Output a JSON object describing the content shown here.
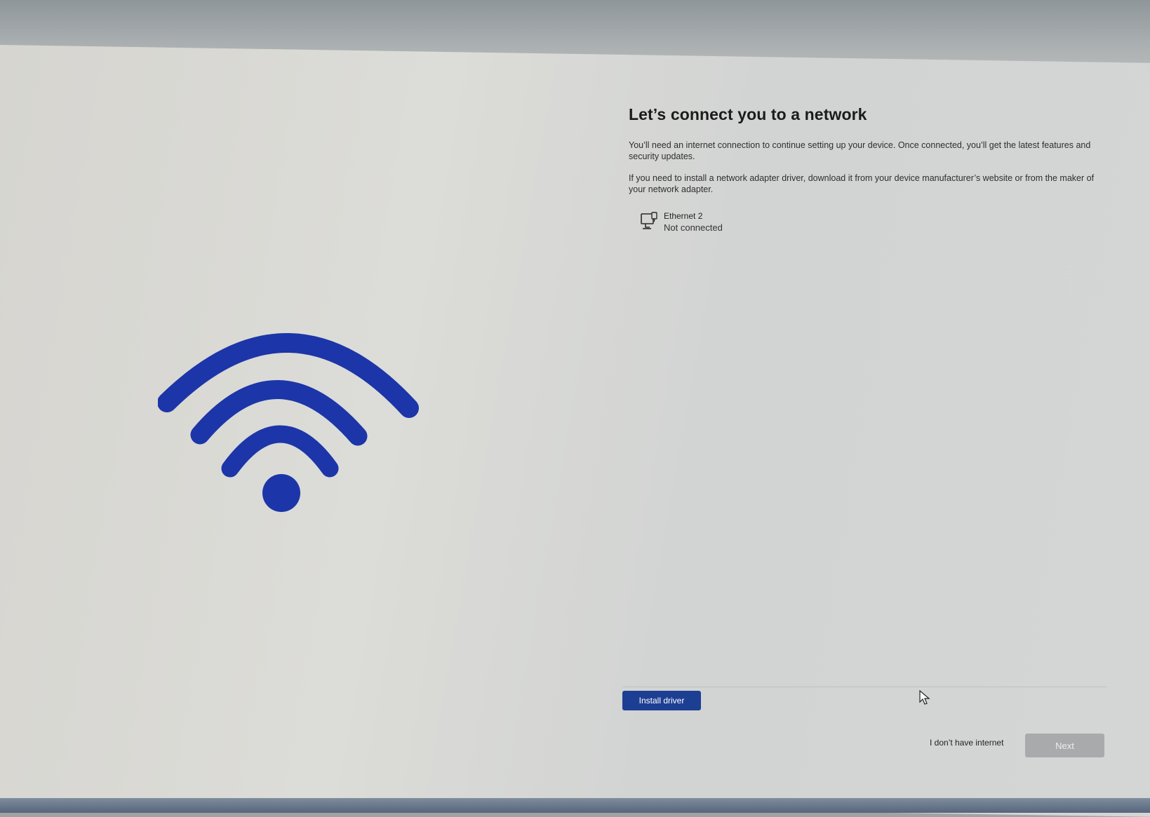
{
  "page": {
    "title": "Let’s connect you to a network",
    "intro": "You’ll need an internet connection to continue setting up your device. Once connected, you’ll get the latest features and security updates.",
    "driver_note": "If you need to install a network adapter driver, download it from your device manufacturer’s website or from the maker of your network adapter."
  },
  "networks": [
    {
      "name": "Ethernet 2",
      "status": "Not connected",
      "icon": "ethernet-icon"
    }
  ],
  "actions": {
    "install_driver": "Install driver",
    "no_internet": "I don’t have internet",
    "next": "Next"
  },
  "illustration": {
    "icon": "wifi-icon",
    "color": "#1c35a8"
  },
  "colors": {
    "accent": "#1d3f93",
    "disabled_button": "#a8aaab"
  }
}
